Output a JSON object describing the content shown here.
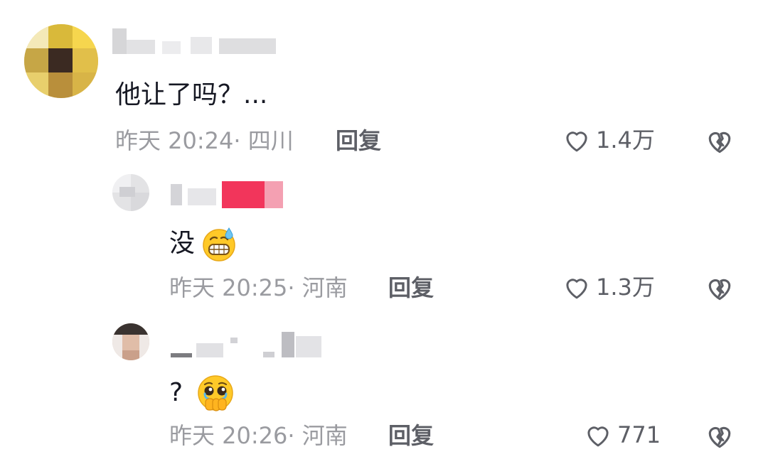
{
  "comments": [
    {
      "text": "他让了吗？...",
      "time": "昨天 20:24",
      "location": "· 四川",
      "reply_label": "回复",
      "like_count": "1.4万"
    },
    {
      "text": "没",
      "emoji": "grin-sweat-emoji",
      "time": "昨天 20:25",
      "location": "· 河南",
      "reply_label": "回复",
      "like_count": "1.3万"
    },
    {
      "text": "?",
      "emoji": "holding-back-tears-emoji",
      "time": "昨天 20:26",
      "location": "· 河南",
      "reply_label": "回复",
      "like_count": "771"
    }
  ],
  "icons": {
    "like": "heart-icon",
    "dislike": "broken-heart-icon"
  },
  "colors": {
    "meta_text": "#9a9ba0",
    "action_text": "#5d5f66",
    "icon_stroke": "#5d5f66",
    "emoji_yellow": "#ffc928"
  }
}
